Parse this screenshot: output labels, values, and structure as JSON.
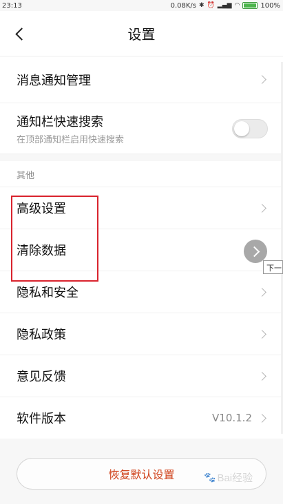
{
  "status_bar": {
    "time": "23:13",
    "speed": "0.08K/s",
    "battery_percent": "100%",
    "battery_level": 1.0
  },
  "header": {
    "title": "设置"
  },
  "rows": {
    "notifications": {
      "label": "消息通知管理"
    },
    "quick_search": {
      "label": "通知栏快速搜索",
      "sublabel": "在顶部通知栏启用快速搜索",
      "enabled": false
    }
  },
  "section_other": {
    "title": "其他",
    "items": {
      "advanced": "高级设置",
      "clear_data": "清除数据",
      "privacy_security": "隐私和安全",
      "privacy_policy": "隐私政策",
      "feedback": "意见反馈",
      "version_label": "软件版本",
      "version_value": "V10.1.2"
    }
  },
  "footer": {
    "reset_label": "恢复默认设置"
  },
  "overlay": {
    "tooltip": "下一",
    "watermark": "Bai经验"
  },
  "colors": {
    "accent_red": "#d0421b",
    "highlight_box": "#d9232d",
    "battery_green": "#4cb54c"
  }
}
